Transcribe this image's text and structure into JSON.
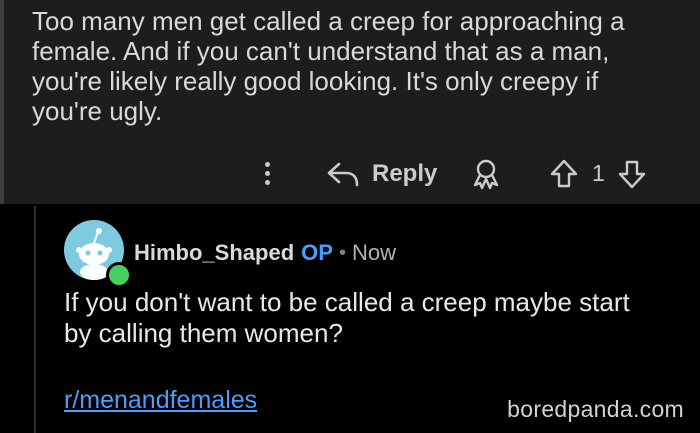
{
  "parent_comment": {
    "text_lines": [
      "Too many men get called a creep for approaching a",
      "female. And if you can't understand that as a man,",
      "you're likely really good looking. It's only creepy if",
      "you're ugly."
    ],
    "actions": {
      "more_icon": "vertical-ellipsis-icon",
      "reply_label": "Reply",
      "award_icon": "award-icon",
      "upvote_icon": "arrow-up-icon",
      "score": "1",
      "downvote_icon": "arrow-down-icon"
    }
  },
  "reply_comment": {
    "username": "Himbo_Shaped",
    "op_badge": "OP",
    "separator": "•",
    "time": "Now",
    "text_lines": [
      "If you don't want to be called a creep maybe start",
      "by calling them women?"
    ],
    "subreddit_link": "r/menandfemales"
  },
  "watermark": "boredpanda.com",
  "colors": {
    "background": "#000000",
    "parent_background": "#1b1d1f",
    "link_blue": "#4a9eff",
    "online_green": "#46d160",
    "avatar_bg": "#7ecbe0"
  }
}
